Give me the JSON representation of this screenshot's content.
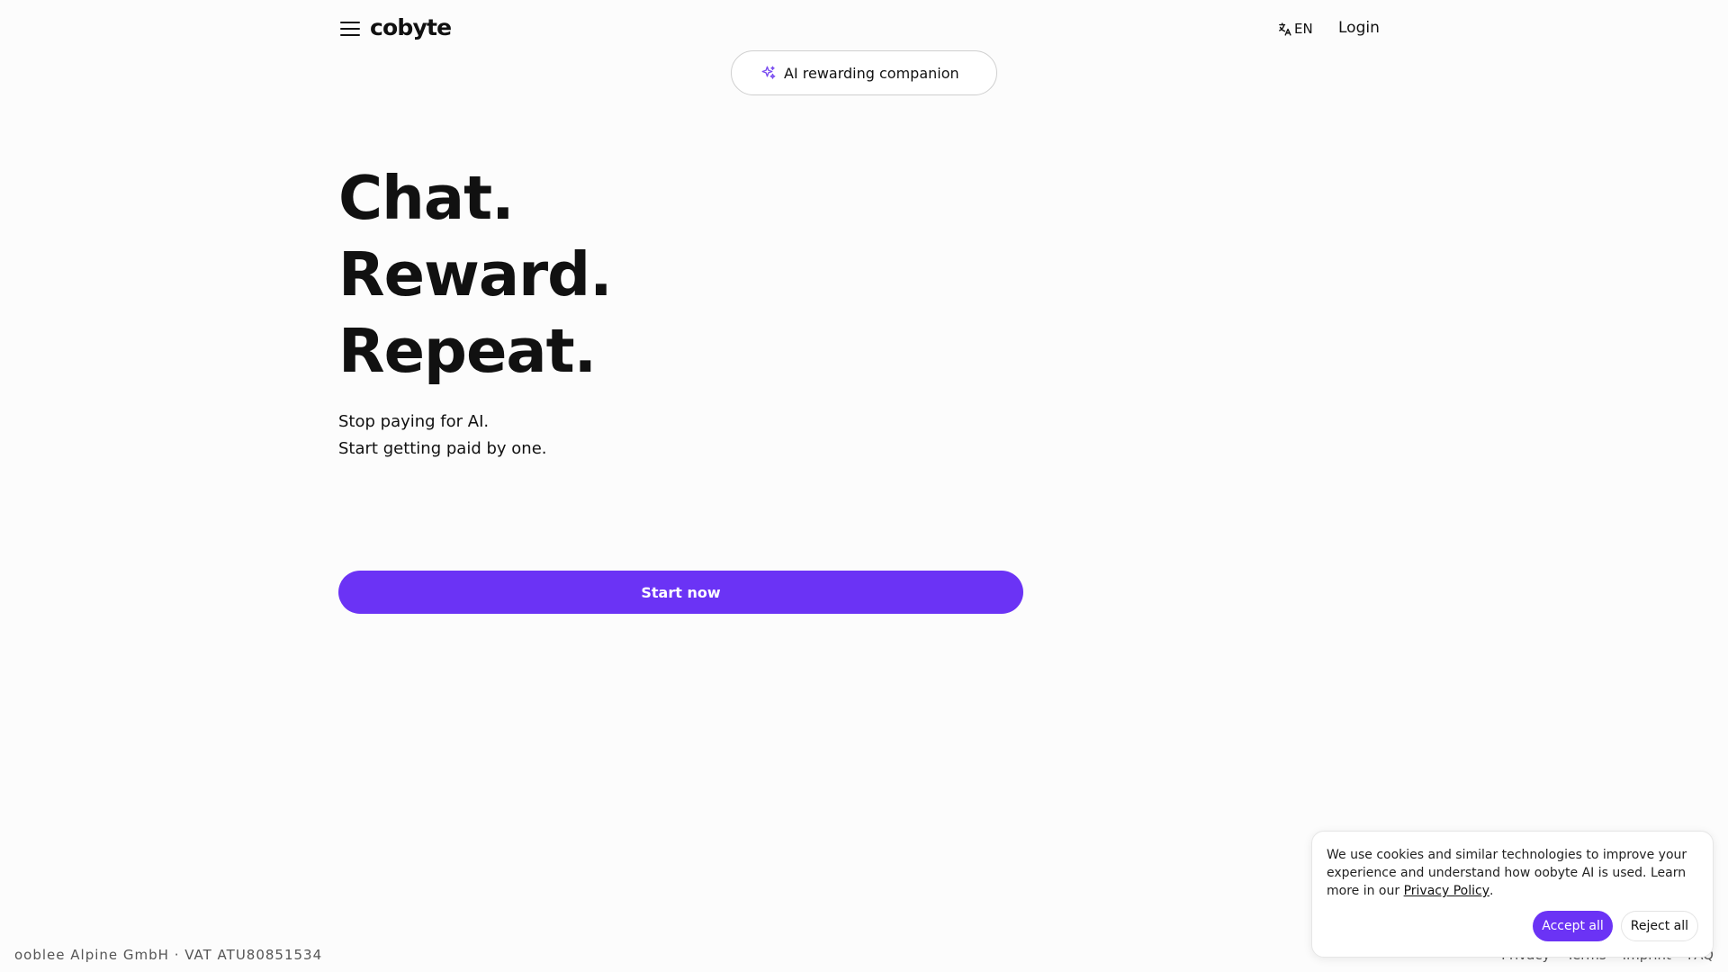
{
  "header": {
    "logo_text": "cobyte",
    "language": "EN",
    "login_label": "Login"
  },
  "pill": {
    "label": "AI rewarding companion",
    "icon": "sparkle-icon"
  },
  "hero": {
    "lines": [
      "Chat.",
      "Reward.",
      "Repeat."
    ],
    "subtitle_lines": [
      "Stop paying for AI.",
      "Start getting paid by one."
    ],
    "cta_label": "Start now"
  },
  "footer": {
    "company": "ooblee Alpine GmbH · VAT ATU80851534",
    "links": [
      "Privacy",
      "Terms",
      "Imprint",
      "FAQ"
    ]
  },
  "cookie": {
    "text_before": "We use cookies and similar technologies to improve your experience and understand how oobyte AI is used. Learn more in our ",
    "link_label": "Privacy Policy",
    "text_after": ".",
    "accept_label": "Accept all",
    "reject_label": "Reject all"
  },
  "colors": {
    "accent": "#6b33f5",
    "background": "#fcfcfc",
    "text": "#111111"
  }
}
